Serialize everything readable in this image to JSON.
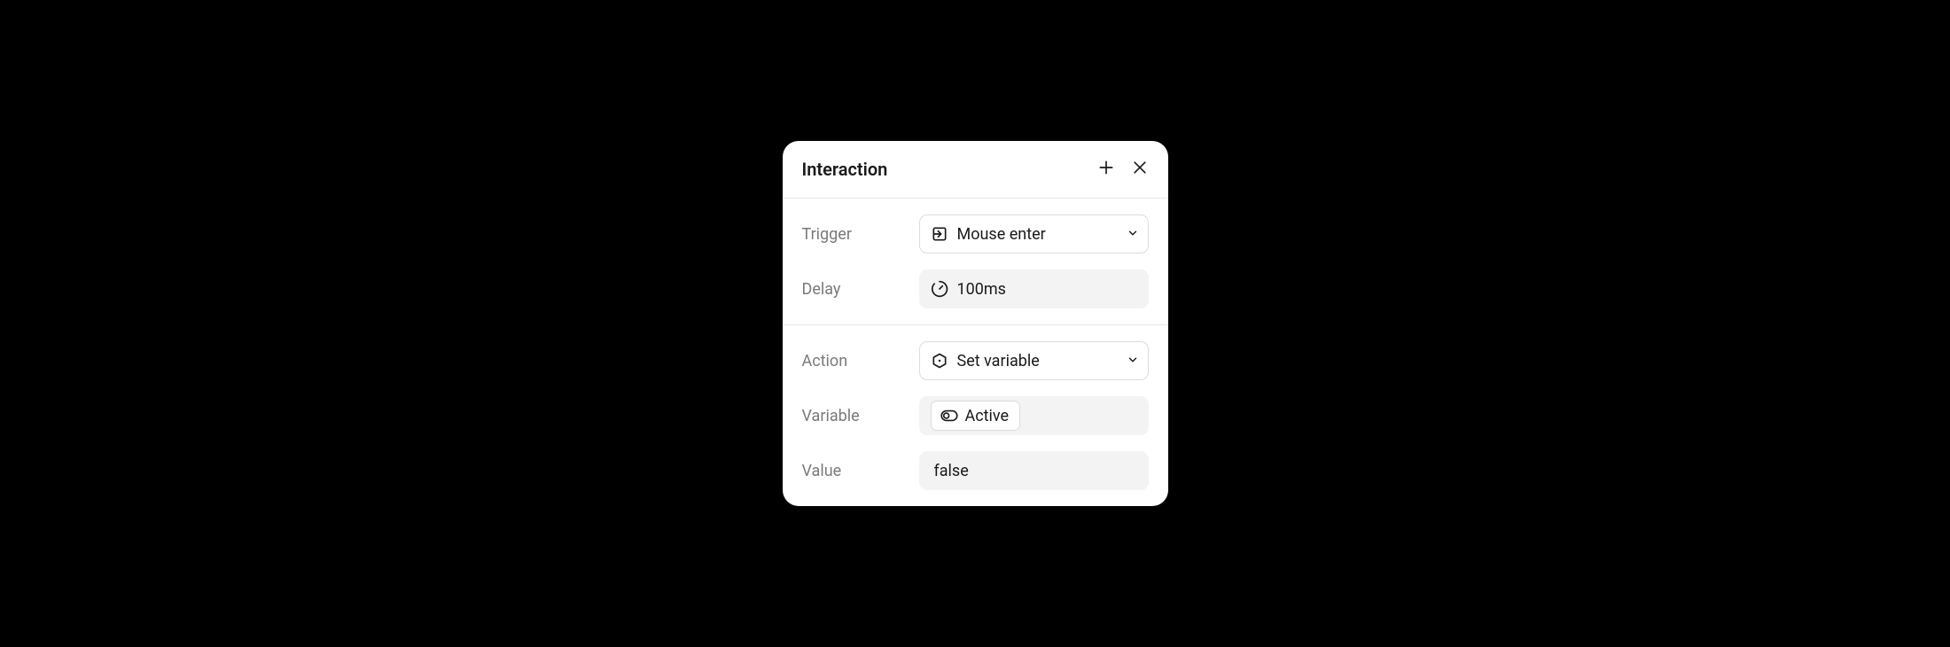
{
  "panel": {
    "title": "Interaction",
    "section1": {
      "trigger": {
        "label": "Trigger",
        "value": "Mouse enter"
      },
      "delay": {
        "label": "Delay",
        "value": "100ms"
      }
    },
    "section2": {
      "action": {
        "label": "Action",
        "value": "Set variable"
      },
      "variable": {
        "label": "Variable",
        "value": "Active"
      },
      "value": {
        "label": "Value",
        "value": "false"
      }
    }
  }
}
